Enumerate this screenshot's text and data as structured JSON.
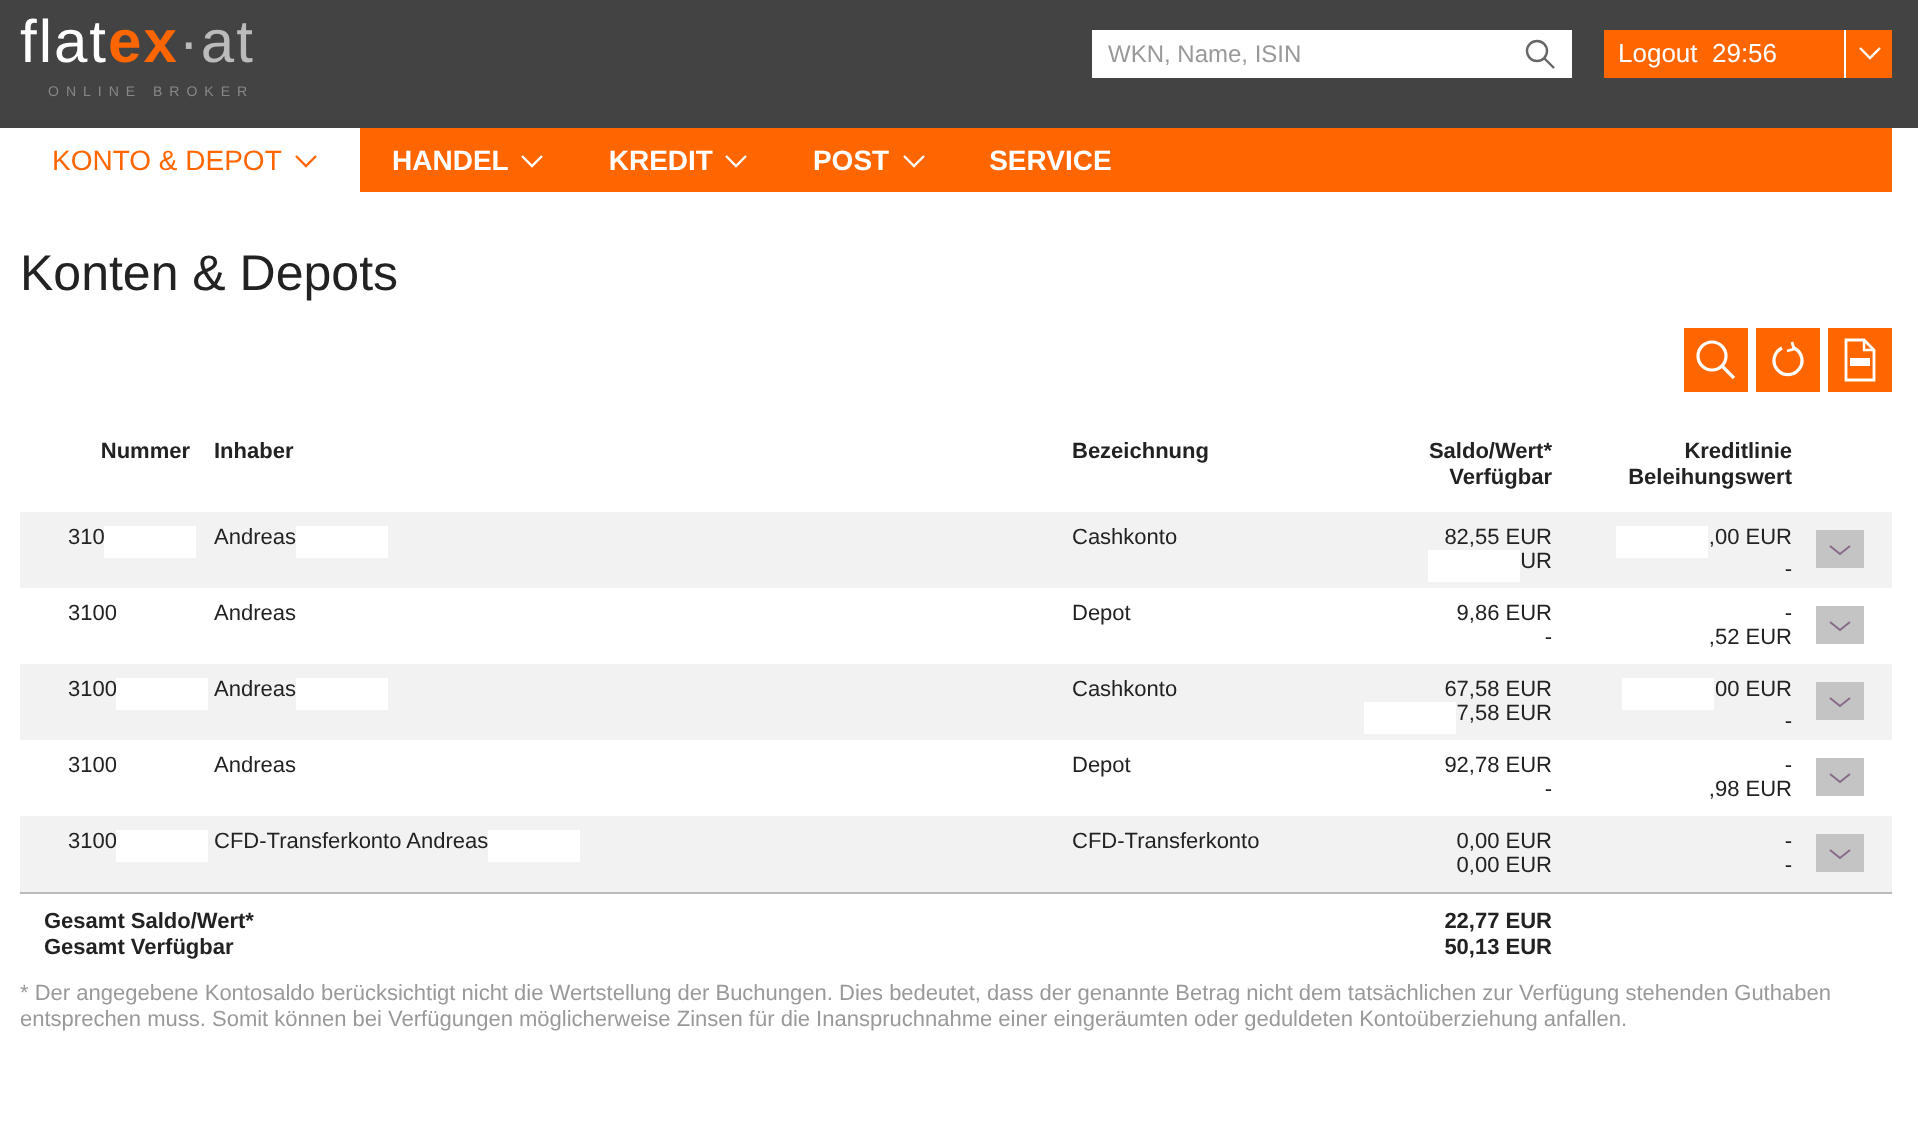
{
  "header": {
    "logo": {
      "brand_main": "flat",
      "brand_accent": "ex",
      "brand_suffix": "·at",
      "tagline": "ONLINE BROKER"
    },
    "search": {
      "placeholder": "WKN, Name, ISIN"
    },
    "logout": {
      "label": "Logout",
      "timer": "29:56"
    }
  },
  "nav": [
    {
      "label": "KONTO & DEPOT",
      "selected": true,
      "dropdown": true
    },
    {
      "label": "HANDEL",
      "selected": false,
      "dropdown": true
    },
    {
      "label": "KREDIT",
      "selected": false,
      "dropdown": true
    },
    {
      "label": "POST",
      "selected": false,
      "dropdown": true
    },
    {
      "label": "SERVICE",
      "selected": false,
      "dropdown": false
    }
  ],
  "page_title": "Konten & Depots",
  "table": {
    "columns": [
      {
        "lines": [
          "Nummer"
        ]
      },
      {
        "lines": [
          "Inhaber"
        ]
      },
      {
        "lines": [
          "Bezeichnung"
        ]
      },
      {
        "lines": [
          "Saldo/Wert*",
          "Verfügbar"
        ]
      },
      {
        "lines": [
          "Kreditlinie",
          "Beleihungswert"
        ]
      }
    ],
    "rows": [
      {
        "nummer": "310",
        "inhaber": "Andreas",
        "bezeichnung": "Cashkonto",
        "saldo": "82,55 EUR",
        "verfuegbar": "UR",
        "kreditlinie": ",00 EUR",
        "beleihungswert": "-",
        "redacted": {
          "nummer": true,
          "inhaber": true,
          "verfuegbar": true,
          "kreditlinie": true
        }
      },
      {
        "nummer": "3100",
        "inhaber": "Andreas",
        "bezeichnung": "Depot",
        "saldo": "9,86 EUR",
        "verfuegbar": "-",
        "kreditlinie": "-",
        "beleihungswert": ",52 EUR",
        "redacted": {
          "nummer": false,
          "inhaber": false,
          "verfuegbar": false,
          "kreditlinie": false
        }
      },
      {
        "nummer": "3100",
        "inhaber": "Andreas",
        "bezeichnung": "Cashkonto",
        "saldo": "67,58 EUR",
        "verfuegbar": "7,58 EUR",
        "kreditlinie": "00 EUR",
        "beleihungswert": "-",
        "redacted": {
          "nummer": true,
          "inhaber": true,
          "verfuegbar": true,
          "kreditlinie": true
        }
      },
      {
        "nummer": "3100",
        "inhaber": "Andreas",
        "bezeichnung": "Depot",
        "saldo": "92,78 EUR",
        "verfuegbar": "-",
        "kreditlinie": "-",
        "beleihungswert": ",98 EUR",
        "redacted": {
          "nummer": false,
          "inhaber": false,
          "verfuegbar": false,
          "kreditlinie": false
        }
      },
      {
        "nummer": "3100",
        "inhaber": "CFD-Transferkonto Andreas",
        "bezeichnung": "CFD-Transferkonto",
        "saldo": "0,00 EUR",
        "verfuegbar": "0,00 EUR",
        "kreditlinie": "-",
        "beleihungswert": "-",
        "redacted": {
          "nummer": true,
          "inhaber": true,
          "verfuegbar": false,
          "kreditlinie": false
        }
      }
    ]
  },
  "totals": [
    {
      "label": "Gesamt Saldo/Wert*",
      "value": "22,77 EUR"
    },
    {
      "label": "Gesamt Verfügbar",
      "value": "50,13 EUR"
    }
  ],
  "footnote": "* Der angegebene Kontosaldo berücksichtigt nicht die Wertstellung der Buchungen. Dies bedeutet, dass der genannte Betrag nicht dem tatsächlichen zur Verfügung stehenden Guthaben entsprechen muss. Somit können bei Verfügungen möglicherweise Zinsen für die Inanspruchnahme einer eingeräumten oder geduldeten Kontoüberziehung anfallen."
}
